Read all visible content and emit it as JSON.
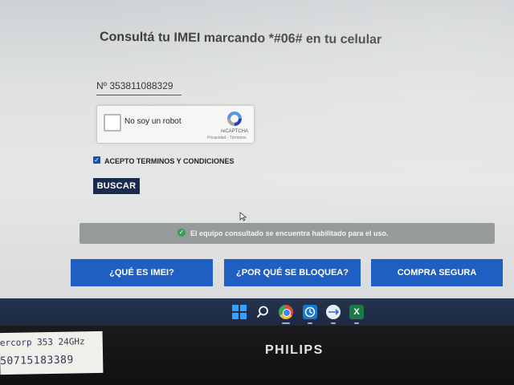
{
  "page": {
    "title": "Consultá tu IMEI marcando *#06# en tu celular",
    "imei_field": "Nº  353811088329",
    "recaptcha": {
      "label": "No soy un robot",
      "brand": "reCAPTCHA",
      "terms": "Privacidad - Términos"
    },
    "terms_checkbox": {
      "checked": true,
      "label": "ACEPTO TERMINOS Y CONDICIONES"
    },
    "search_button": "BUSCAR",
    "status_message": "El equipo consultado se encuentra habilitado para el uso.",
    "nav_buttons": [
      "¿QUÉ ES IMEI?",
      "¿POR QUÉ SE BLOQUEA?",
      "COMPRA SEGURA"
    ]
  },
  "taskbar": {
    "icons": [
      "windows-start-icon",
      "search-icon",
      "chrome-icon",
      "clock-icon",
      "network-icon",
      "excel-icon"
    ]
  },
  "monitor": {
    "brand": "PHILIPS"
  },
  "sticker": {
    "line1": "ercorp 353 24GHz",
    "line2": "50715183389"
  },
  "colors": {
    "nav_button": "#1f5fc4",
    "search_button": "#1b2b4f",
    "status_bar": "#979a9a",
    "success": "#2ea44f"
  }
}
